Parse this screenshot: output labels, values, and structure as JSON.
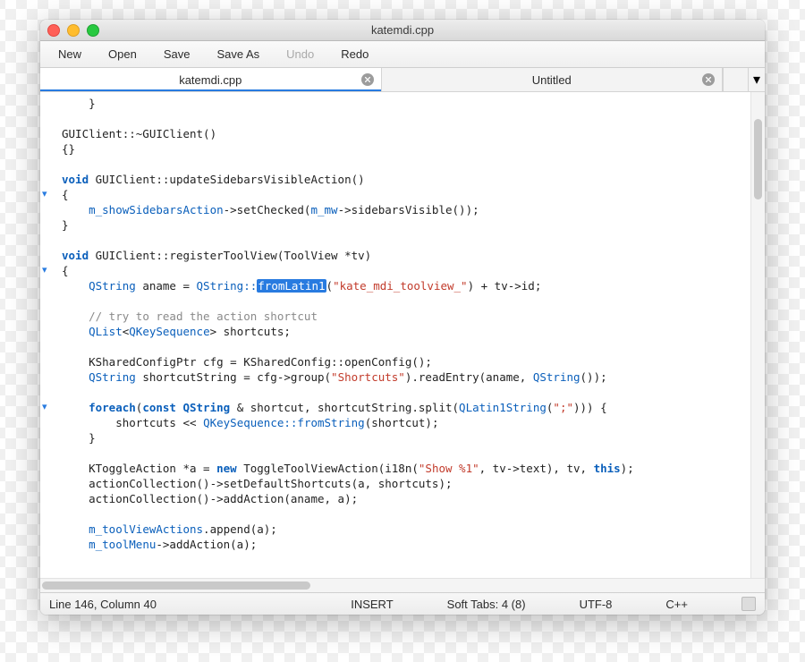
{
  "window": {
    "title": "katemdi.cpp"
  },
  "toolbar": {
    "new": "New",
    "open": "Open",
    "save": "Save",
    "save_as": "Save As",
    "undo": "Undo",
    "redo": "Redo"
  },
  "tabs": {
    "items": [
      {
        "label": "katemdi.cpp",
        "active": true
      },
      {
        "label": "Untitled",
        "active": false
      }
    ],
    "overflow_glyph": "▾"
  },
  "code": {
    "lines": [
      {
        "indent": 1,
        "frags": [
          {
            "t": "}",
            "c": ""
          }
        ]
      },
      {
        "indent": 0,
        "frags": []
      },
      {
        "indent": 0,
        "frags": [
          {
            "t": "GUIClient::~GUIClient()",
            "c": ""
          }
        ]
      },
      {
        "indent": 0,
        "frags": [
          {
            "t": "{}",
            "c": ""
          }
        ]
      },
      {
        "indent": 0,
        "frags": []
      },
      {
        "indent": 0,
        "frags": [
          {
            "t": "void",
            "c": "kw"
          },
          {
            "t": " GUIClient::updateSidebarsVisibleAction()",
            "c": ""
          }
        ]
      },
      {
        "indent": 0,
        "fold": true,
        "frags": [
          {
            "t": "{",
            "c": ""
          }
        ]
      },
      {
        "indent": 1,
        "frags": [
          {
            "t": "m_showSidebarsAction",
            "c": "type"
          },
          {
            "t": "->setChecked(",
            "c": ""
          },
          {
            "t": "m_mw",
            "c": "type"
          },
          {
            "t": "->sidebarsVisible());",
            "c": ""
          }
        ]
      },
      {
        "indent": 0,
        "frags": [
          {
            "t": "}",
            "c": ""
          }
        ]
      },
      {
        "indent": 0,
        "frags": []
      },
      {
        "indent": 0,
        "frags": [
          {
            "t": "void",
            "c": "kw"
          },
          {
            "t": " GUIClient::registerToolView(ToolView *tv)",
            "c": ""
          }
        ]
      },
      {
        "indent": 0,
        "fold": true,
        "frags": [
          {
            "t": "{",
            "c": ""
          }
        ]
      },
      {
        "indent": 1,
        "frags": [
          {
            "t": "QString",
            "c": "type"
          },
          {
            "t": " aname = ",
            "c": ""
          },
          {
            "t": "QString::",
            "c": "type"
          },
          {
            "t": "fromLatin1",
            "c": "sel"
          },
          {
            "t": "(",
            "c": ""
          },
          {
            "t": "\"kate_mdi_toolview_\"",
            "c": "str"
          },
          {
            "t": ") + tv->id;",
            "c": ""
          }
        ]
      },
      {
        "indent": 0,
        "frags": []
      },
      {
        "indent": 1,
        "frags": [
          {
            "t": "// try to read the action shortcut",
            "c": "cmt"
          }
        ]
      },
      {
        "indent": 1,
        "frags": [
          {
            "t": "QList",
            "c": "type"
          },
          {
            "t": "<",
            "c": ""
          },
          {
            "t": "QKeySequence",
            "c": "type"
          },
          {
            "t": "> shortcuts;",
            "c": ""
          }
        ]
      },
      {
        "indent": 0,
        "frags": []
      },
      {
        "indent": 1,
        "frags": [
          {
            "t": "KSharedConfigPtr cfg = KSharedConfig::openConfig();",
            "c": ""
          }
        ]
      },
      {
        "indent": 1,
        "frags": [
          {
            "t": "QString",
            "c": "type"
          },
          {
            "t": " shortcutString = cfg->group(",
            "c": ""
          },
          {
            "t": "\"Shortcuts\"",
            "c": "str"
          },
          {
            "t": ").readEntry(aname, ",
            "c": ""
          },
          {
            "t": "QString",
            "c": "type"
          },
          {
            "t": "());",
            "c": ""
          }
        ]
      },
      {
        "indent": 0,
        "frags": []
      },
      {
        "indent": 1,
        "fold": true,
        "frags": [
          {
            "t": "foreach",
            "c": "kw"
          },
          {
            "t": "(",
            "c": ""
          },
          {
            "t": "const QString",
            "c": "kw"
          },
          {
            "t": " & shortcut, shortcutString.split(",
            "c": ""
          },
          {
            "t": "QLatin1String",
            "c": "type"
          },
          {
            "t": "(",
            "c": ""
          },
          {
            "t": "\";\"",
            "c": "str"
          },
          {
            "t": "))) {",
            "c": ""
          }
        ]
      },
      {
        "indent": 2,
        "frags": [
          {
            "t": "shortcuts << ",
            "c": ""
          },
          {
            "t": "QKeySequence::fromString",
            "c": "type"
          },
          {
            "t": "(shortcut);",
            "c": ""
          }
        ]
      },
      {
        "indent": 1,
        "frags": [
          {
            "t": "}",
            "c": ""
          }
        ]
      },
      {
        "indent": 0,
        "frags": []
      },
      {
        "indent": 1,
        "frags": [
          {
            "t": "KToggleAction *a = ",
            "c": ""
          },
          {
            "t": "new",
            "c": "kw"
          },
          {
            "t": " ToggleToolViewAction(i18n(",
            "c": ""
          },
          {
            "t": "\"Show %1\"",
            "c": "str"
          },
          {
            "t": ", tv->text), tv, ",
            "c": ""
          },
          {
            "t": "this",
            "c": "kw"
          },
          {
            "t": ");",
            "c": ""
          }
        ]
      },
      {
        "indent": 1,
        "frags": [
          {
            "t": "actionCollection()->setDefaultShortcuts(a, shortcuts);",
            "c": ""
          }
        ]
      },
      {
        "indent": 1,
        "frags": [
          {
            "t": "actionCollection()->addAction(aname, a);",
            "c": ""
          }
        ]
      },
      {
        "indent": 0,
        "frags": []
      },
      {
        "indent": 1,
        "frags": [
          {
            "t": "m_toolViewActions",
            "c": "type"
          },
          {
            "t": ".append(a);",
            "c": ""
          }
        ]
      },
      {
        "indent": 1,
        "frags": [
          {
            "t": "m_toolMenu",
            "c": "type"
          },
          {
            "t": "->addAction(a);",
            "c": ""
          }
        ]
      }
    ]
  },
  "status": {
    "position": "Line 146, Column 40",
    "mode": "INSERT",
    "tabs": "Soft Tabs: 4 (8)",
    "encoding": "UTF-8",
    "lang": "C++"
  }
}
